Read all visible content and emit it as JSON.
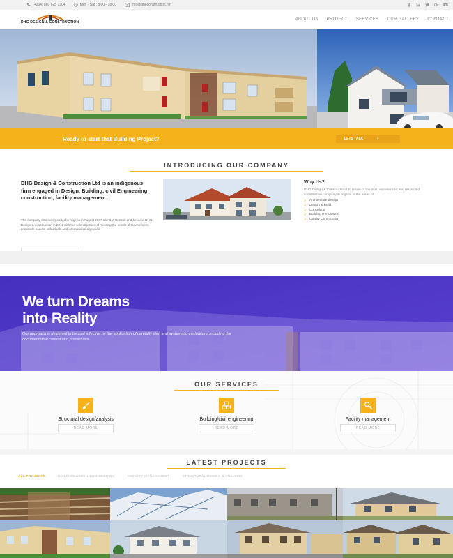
{
  "topbar": {
    "phone": "(+234) 803 675 7304",
    "hours": "Mon - Sat : 8:00 - 18:00",
    "email": "info@dhgconstruction.net",
    "social_icons": [
      "facebook-icon",
      "linkedin-icon",
      "twitter-icon",
      "google-plus-icon",
      "youtube-icon"
    ]
  },
  "header": {
    "logo_text": "DHG DESIGN & CONSTRUCTION",
    "nav": [
      "ABOUT US",
      "PROJECT",
      "SERVICES",
      "OUR GALLERY",
      "CONTACT"
    ]
  },
  "hero": {
    "cta_text": "Ready to start that Building Project?",
    "cta_button": "LETS TALK"
  },
  "intro": {
    "title": "INTRODUCING OUR COMPANY",
    "lead": "DHG Design & Construction Ltd is an indigenous firm engaged in Design, Building, civil Engineering construction, facility management .",
    "body": "The company was incorporated in Nigeria in August 2007 as A&M Consult and became DHG Design & construction in 2011 with the sole objective of meeting the needs of Government, corporate bodies, individuals and international agencies.",
    "why_title": "Why Us?",
    "why_text": "DHG Design & Construction Ltd is one of the most experienced and respected construction company in Nigeria in the areas of:",
    "why_items": [
      "Architecture design",
      "Design & Build",
      "Consulting",
      "Building Renovation",
      "Quality Construction"
    ]
  },
  "dream": {
    "title_line1": "We turn Dreams",
    "title_line2": "into Reality",
    "text": "Our approach is designed to be cost effective by the application of carefully plan and systematic evaluations including the documentation control and procedures."
  },
  "services": {
    "title": "OUR SERVICES",
    "items": [
      {
        "title": "Structural design/analysis",
        "button": "READ MORE",
        "icon": "brush-icon"
      },
      {
        "title": "Building/civil engineering",
        "button": "READ MORE",
        "icon": "cubes-icon"
      },
      {
        "title": "Facility management",
        "button": "READ MORE",
        "icon": "key-icon"
      }
    ]
  },
  "projects": {
    "title": "LATEST PROJECTS",
    "filters": [
      "ALL PROJECTS",
      "BUILDING & CIVIL ENGINEERING",
      "FACILITY MANAGEMENT",
      "STRUCTURAL DESIGN & ANALYSIS"
    ]
  },
  "colors": {
    "accent": "#f6b21b",
    "purple": "#4b35c4"
  }
}
